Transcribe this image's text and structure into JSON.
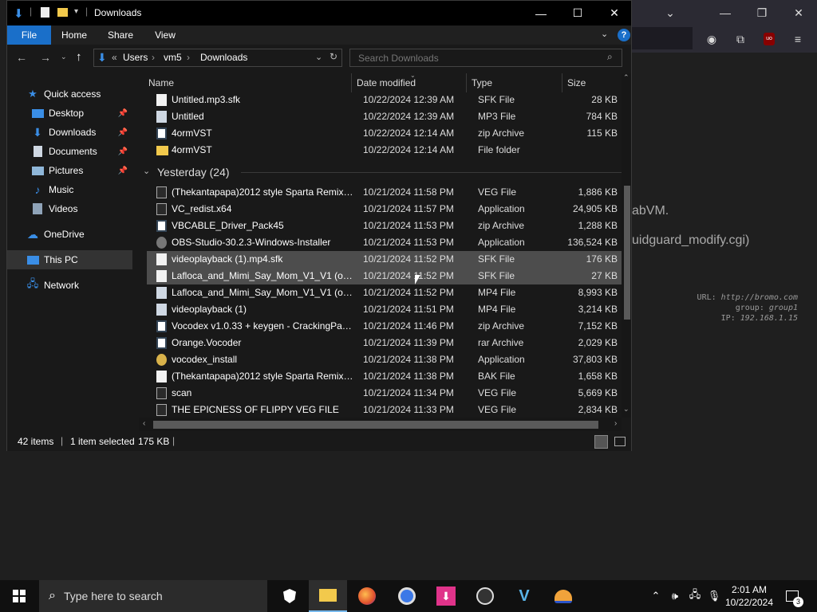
{
  "background_window": {
    "text_line1": "abVM.",
    "text_line2": "uidguard_modify.cgi)",
    "info_url_label": "URL:",
    "info_url": "http://bromo.com",
    "info_group_label": "group:",
    "info_group": "group1",
    "info_ip_label": "IP:",
    "info_ip": "192.168.1.15",
    "toolbar_icons": [
      "account-icon",
      "extensions-icon",
      "ublock-icon",
      "menu-icon"
    ]
  },
  "explorer": {
    "title": "Downloads",
    "ribbon_tabs": [
      "File",
      "Home",
      "Share",
      "View"
    ],
    "breadcrumb": [
      "Users",
      "vm5",
      "Downloads"
    ],
    "breadcrumb_prefix": "«",
    "search_placeholder": "Search Downloads",
    "columns": [
      "Name",
      "Date modified",
      "Type",
      "Size"
    ],
    "nav": {
      "quick_access": "Quick access",
      "pinned": [
        "Desktop",
        "Downloads",
        "Documents",
        "Pictures"
      ],
      "unpinned": [
        "Music",
        "Videos"
      ],
      "onedrive": "OneDrive",
      "this_pc": "This PC",
      "network": "Network"
    },
    "today_rows": [
      {
        "name": "Untitled.mp3.sfk",
        "date": "10/22/2024 12:39 AM",
        "type": "SFK File",
        "size": "28 KB",
        "icon": "doc"
      },
      {
        "name": "Untitled",
        "date": "10/22/2024 12:39 AM",
        "type": "MP3 File",
        "size": "784 KB",
        "icon": "media"
      },
      {
        "name": "4ormVST",
        "date": "10/22/2024 12:14 AM",
        "type": "zip Archive",
        "size": "115 KB",
        "icon": "zip"
      },
      {
        "name": "4ormVST",
        "date": "10/22/2024 12:14 AM",
        "type": "File folder",
        "size": "",
        "icon": "folder"
      }
    ],
    "group_label": "Yesterday (24)",
    "yesterday_rows": [
      {
        "name": "(Thekantapapa)2012 style Sparta Remix(2)",
        "date": "10/21/2024 11:58 PM",
        "type": "VEG File",
        "size": "1,886 KB",
        "icon": "app"
      },
      {
        "name": "VC_redist.x64",
        "date": "10/21/2024 11:57 PM",
        "type": "Application",
        "size": "24,905 KB",
        "icon": "app"
      },
      {
        "name": "VBCABLE_Driver_Pack45",
        "date": "10/21/2024 11:53 PM",
        "type": "zip Archive",
        "size": "1,288 KB",
        "icon": "zip"
      },
      {
        "name": "OBS-Studio-30.2.3-Windows-Installer",
        "date": "10/21/2024 11:53 PM",
        "type": "Application",
        "size": "136,524 KB",
        "icon": "round"
      },
      {
        "name": "videoplayback (1).mp4.sfk",
        "date": "10/21/2024 11:52 PM",
        "type": "SFK File",
        "size": "176 KB",
        "icon": "doc",
        "selected": true
      },
      {
        "name": "Lafloca_and_Mimi_Say_Mom_V1_V1 (onli...",
        "date": "10/21/2024 11:52 PM",
        "type": "SFK File",
        "size": "27 KB",
        "icon": "doc",
        "hover": true
      },
      {
        "name": "Lafloca_and_Mimi_Say_Mom_V1_V1 (onli...",
        "date": "10/21/2024 11:52 PM",
        "type": "MP4 File",
        "size": "8,993 KB",
        "icon": "media"
      },
      {
        "name": "videoplayback (1)",
        "date": "10/21/2024 11:51 PM",
        "type": "MP4 File",
        "size": "3,214 KB",
        "icon": "media"
      },
      {
        "name": "Vocodex v1.0.33 + keygen - CrackingPatc...",
        "date": "10/21/2024 11:46 PM",
        "type": "zip Archive",
        "size": "7,152 KB",
        "icon": "zip"
      },
      {
        "name": "Orange.Vocoder",
        "date": "10/21/2024 11:39 PM",
        "type": "rar Archive",
        "size": "2,029 KB",
        "icon": "zip"
      },
      {
        "name": "vocodex_install",
        "date": "10/21/2024 11:38 PM",
        "type": "Application",
        "size": "37,803 KB",
        "icon": "gold"
      },
      {
        "name": "(Thekantapapa)2012 style Sparta Remix(2...",
        "date": "10/21/2024 11:38 PM",
        "type": "BAK File",
        "size": "1,658 KB",
        "icon": "doc"
      },
      {
        "name": "scan",
        "date": "10/21/2024 11:34 PM",
        "type": "VEG File",
        "size": "5,669 KB",
        "icon": "app"
      },
      {
        "name": "THE EPICNESS OF FLIPPY VEG FILE",
        "date": "10/21/2024 11:33 PM",
        "type": "VEG File",
        "size": "2,834 KB",
        "icon": "app"
      }
    ],
    "status": {
      "items": "42 items",
      "selected": "1 item selected",
      "size": "175 KB"
    }
  },
  "taskbar": {
    "search_placeholder": "Type here to search",
    "time": "2:01 AM",
    "date": "10/22/2024",
    "notification_count": "3",
    "apps": [
      "security-icon",
      "file-explorer-icon",
      "firefox-icon",
      "chrome-icon",
      "download-app-icon",
      "obs-icon",
      "vegas-icon",
      "vpn-icon"
    ]
  },
  "colors": {
    "accent": "#1a6fc9",
    "selection": "#4d4d4d",
    "window_bg": "#191919"
  }
}
